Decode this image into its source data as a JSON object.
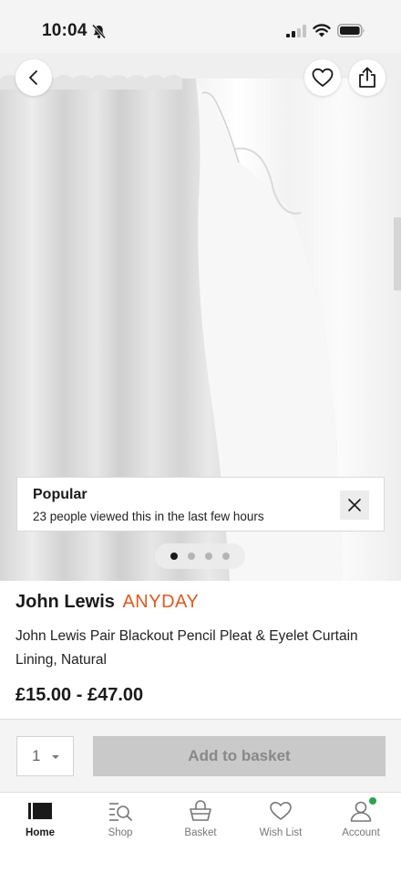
{
  "status_bar": {
    "time": "10:04"
  },
  "hero": {
    "banner": {
      "title": "Popular",
      "subtitle": "23 people viewed this in the last few hours"
    },
    "pager": {
      "count": 4,
      "active_index": 0
    }
  },
  "product": {
    "brand": "John Lewis",
    "range": "ANYDAY",
    "title": "John Lewis Pair Blackout Pencil Pleat & Eyelet Curtain Lining, Natural",
    "price": "£15.00 - £47.00"
  },
  "basket": {
    "quantity": "1",
    "add_label": "Add to basket"
  },
  "tabs": [
    {
      "label": "Home",
      "icon": "home-icon",
      "active": true
    },
    {
      "label": "Shop",
      "icon": "shop-search-icon",
      "active": false
    },
    {
      "label": "Basket",
      "icon": "basket-icon",
      "active": false
    },
    {
      "label": "Wish List",
      "icon": "heart-icon",
      "active": false
    },
    {
      "label": "Account",
      "icon": "account-icon",
      "active": false,
      "badge": true
    }
  ],
  "colors": {
    "brand_accent": "#e05a1e",
    "disabled_button": "#c9c9c9",
    "badge_green": "#2aa54b"
  }
}
